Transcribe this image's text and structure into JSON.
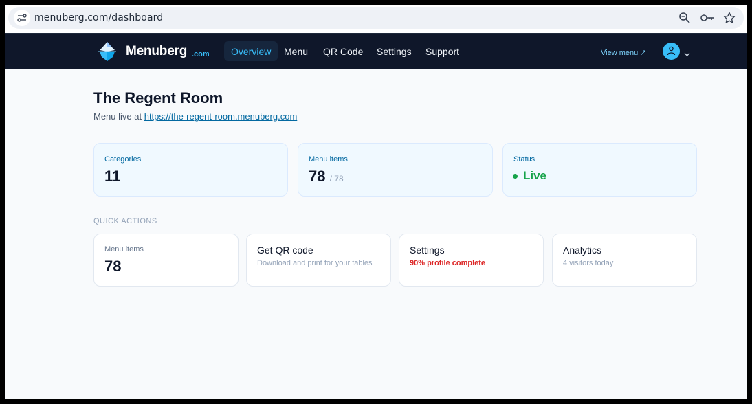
{
  "browser": {
    "url": "menuberg.com/dashboard"
  },
  "nav": {
    "brand": "Menuberg",
    "brand_suffix": ".com",
    "links": [
      "Overview",
      "Menu",
      "QR Code",
      "Settings",
      "Support"
    ],
    "active": "Overview",
    "view_menu": "View menu ↗"
  },
  "page": {
    "title": "The Regent Room",
    "subtitle_prefix": "Menu live at",
    "live_url": "https://the-regent-room.menuberg.com"
  },
  "stats": [
    {
      "label": "Categories",
      "value": "11",
      "sub": ""
    },
    {
      "label": "Menu items",
      "value": "78",
      "sub": "/ 78"
    },
    {
      "label": "Status",
      "value": "Live",
      "sub": ""
    }
  ],
  "quick_actions": {
    "heading": "QUICK ACTIONS",
    "cards": [
      {
        "title": "Menu items",
        "value": "78"
      },
      {
        "title": "Get QR code",
        "desc": "Download and print for your tables"
      },
      {
        "title": "Settings",
        "desc": "90% profile complete"
      },
      {
        "title": "Analytics",
        "desc": "4 visitors today"
      }
    ]
  },
  "colors": {
    "nav_bg": "#0f172a",
    "accent": "#38bdf8",
    "live": "#16a34a",
    "warning": "#dc2626"
  }
}
